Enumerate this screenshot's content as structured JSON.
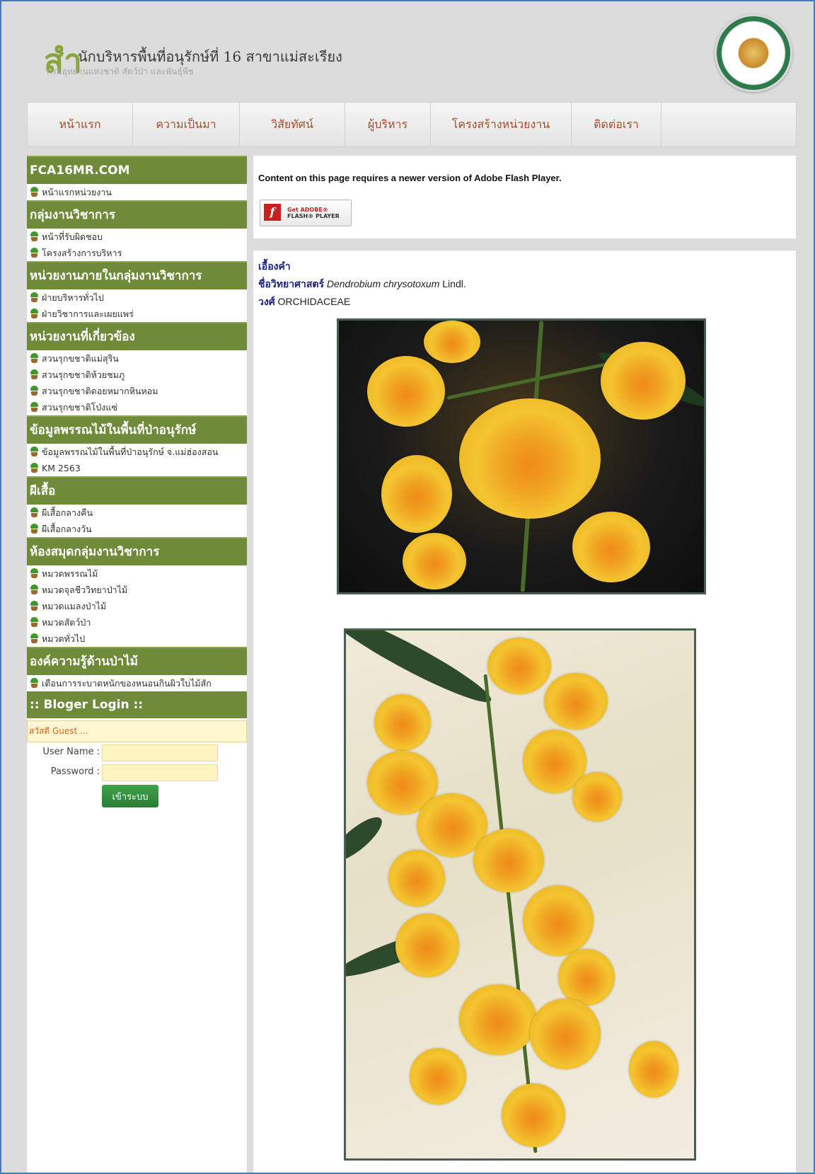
{
  "header": {
    "logo_big_char": "สำ",
    "title": "นักบริหารพื้นที่อนุรักษ์ที่ 16 สาขาแม่สะเรียง",
    "subtitle": "กรมอุทยานแห่งชาติ สัตว์ป่า และพันธุ์พืช",
    "seal_icon": "department-seal-icon"
  },
  "nav": {
    "items": [
      "หน้าแรก",
      "ความเป็นมา",
      "วิสัยทัศน์",
      "ผู้บริหาร",
      "โครงสร้างหน่วยงาน",
      "ติดต่อเรา"
    ]
  },
  "sidebar": {
    "sections": [
      {
        "title": "FCA16MR.COM",
        "links": [
          "หน้าแรกหน่วยงาน"
        ]
      },
      {
        "title": "กลุ่มงานวิชาการ",
        "links": [
          "หน้าที่รับผิดชอบ",
          "โครงสร้างการบริหาร"
        ]
      },
      {
        "title": "หน่วยงานภายในกลุ่มงานวิชาการ",
        "links": [
          "ฝ่ายบริหารทั่วไป",
          "ฝ่ายวิชาการและเผยแพร่"
        ]
      },
      {
        "title": "หน่วยงานที่เกี่ยวข้อง",
        "links": [
          "สวนรุกขชาติแม่สุริน",
          "สวนรุกขชาติห้วยชมภู",
          "สวนรุกขชาติดอยหมากหินหอม",
          "สวนรุกขชาติโป่งแซ่"
        ]
      },
      {
        "title": "ข้อมูลพรรณไม้ในพื้นที่ป่าอนุรักษ์",
        "links": [
          "ข้อมูลพรรณไม้ในพื้นที่ป่าอนุรักษ์ จ.แม่ฮ่องสอน",
          "KM 2563"
        ]
      },
      {
        "title": "ผีเสื้อ",
        "links": [
          "ผีเสื้อกลางคืน",
          "ผีเสื้อกลางวัน"
        ]
      },
      {
        "title": "ห้องสมุดกลุ่มงานวิชาการ",
        "links": [
          "หมวดพรรณไม้",
          "หมวดจุลชีววิทยาป่าไม้",
          "หมวดแมลงป่าไม้",
          "หมวดสัตว์ป่า",
          "หมวดทั่วไป"
        ]
      },
      {
        "title": "องค์ความรู้ด้านป่าไม้",
        "links": [
          "เตือนการระบาดหนักของหนอนกินผิวใบไม้สัก"
        ]
      }
    ],
    "login": {
      "title": ":: Bloger Login ::",
      "greeting": "สวัสดี Guest ...",
      "username_label": "User Name :",
      "password_label": "Password :",
      "submit_label": "เข้าระบบ"
    }
  },
  "flash": {
    "message": "Content on this page requires a newer version of Adobe Flash Player.",
    "button_line1": "Get ADOBE®",
    "button_line2": "FLASH® PLAYER",
    "icon": "flash-player-icon"
  },
  "plant": {
    "common_name": "เอื้องคำ",
    "sci_label": "ชื่อวิทยาศาสตร์",
    "genus": "Dendrobium",
    "species": "chrysotoxum",
    "author": "Lindl.",
    "family_label": "วงศ์",
    "family": "ORCHIDACEAE"
  },
  "colors": {
    "sidebar_header": "#6f8b3a",
    "nav_text": "#a34d2a",
    "login_button": "#2b7d35",
    "frame_border": "#4a7ab8"
  }
}
